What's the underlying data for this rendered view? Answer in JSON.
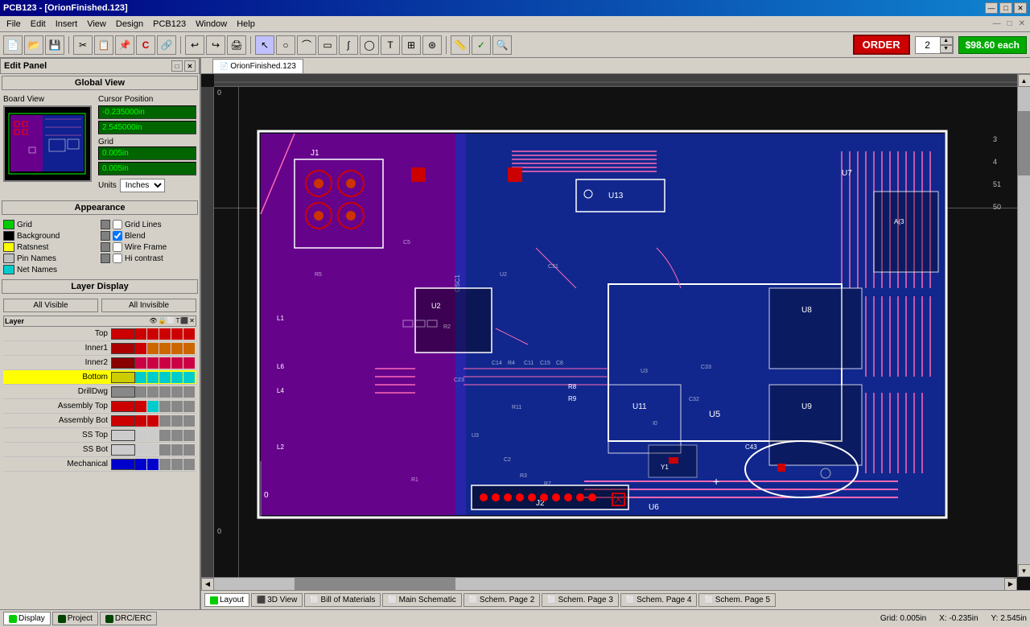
{
  "titleBar": {
    "title": "PCB123 - [OrionFinished.123]",
    "minimize": "—",
    "maximize": "□",
    "close": "✕",
    "innerMinimize": "—",
    "innerMaximize": "□",
    "innerClose": "✕"
  },
  "menuBar": {
    "items": [
      "File",
      "Edit",
      "Insert",
      "View",
      "Design",
      "PCB123",
      "Window",
      "Help"
    ]
  },
  "toolbar": {
    "order": "ORDER",
    "quantity": "2",
    "price": "$98.60 each"
  },
  "documentTab": {
    "name": "OrionFinished.123"
  },
  "leftPanel": {
    "title": "Edit Panel",
    "globalView": "Global View",
    "boardView": "Board View",
    "cursorPosition": "Cursor Position",
    "xValue": "-0.235000in",
    "yValue": "2.545000in",
    "grid": "Grid",
    "gridX": "0.005in",
    "gridY": "0.005in",
    "units": "Units",
    "unitsValue": "Inches",
    "appearance": "Appearance",
    "appearItems": [
      {
        "label": "Grid",
        "color": "#00cc00"
      },
      {
        "label": "Background",
        "color": "#000000"
      },
      {
        "label": "Ratsnest",
        "color": "#ffff00"
      },
      {
        "label": "Pin Names",
        "color": "#ffffff"
      },
      {
        "label": "Net Names",
        "color": "#00ffff"
      }
    ],
    "checkItems": [
      {
        "label": "Grid Lines",
        "checked": false
      },
      {
        "label": "Blend",
        "checked": true
      },
      {
        "label": "Wire Frame",
        "checked": false
      },
      {
        "label": "Hi contrast",
        "checked": false
      }
    ],
    "layerDisplay": "Layer Display",
    "allVisible": "All Visible",
    "allInvisible": "All Invisible",
    "layers": [
      {
        "name": "Top",
        "color": "#cc0000",
        "selected": false
      },
      {
        "name": "Inner1",
        "color": "#cc0000",
        "selected": false
      },
      {
        "name": "Inner2",
        "color": "#cc0000",
        "selected": false
      },
      {
        "name": "Bottom",
        "color": "#cccc00",
        "selected": true
      },
      {
        "name": "DrillDwg",
        "color": "#ffffff",
        "selected": false
      },
      {
        "name": "Assembly Top",
        "color": "#cc0000",
        "selected": false
      },
      {
        "name": "Assembly Bot",
        "color": "#cc0000",
        "selected": false
      },
      {
        "name": "SS Top",
        "color": "#cc0000",
        "selected": false
      },
      {
        "name": "SS Bot",
        "color": "#cc0000",
        "selected": false
      },
      {
        "name": "Mechanical",
        "color": "#cc0000",
        "selected": false
      }
    ]
  },
  "statusBar": {
    "tabs": [
      {
        "label": "Display",
        "icon": "green",
        "active": true
      },
      {
        "label": "Project",
        "icon": "yellow",
        "active": false
      },
      {
        "label": "DRC/ERC",
        "icon": "red",
        "active": false
      }
    ],
    "gridStatus": "Grid: 0.005in",
    "xCoord": "X: -0.235in",
    "yCoord": "Y: 2.545in"
  },
  "bottomTabs": [
    {
      "label": "Layout",
      "icon": "green",
      "active": true
    },
    {
      "label": "3D View",
      "active": false
    },
    {
      "label": "Bill of Materials",
      "active": false
    },
    {
      "label": "Main Schematic",
      "active": false
    },
    {
      "label": "Schem. Page 2",
      "active": false
    },
    {
      "label": "Schem. Page 3",
      "active": false
    },
    {
      "label": "Schem. Page 4",
      "active": false
    },
    {
      "label": "Schem. Page 5",
      "active": false
    }
  ]
}
